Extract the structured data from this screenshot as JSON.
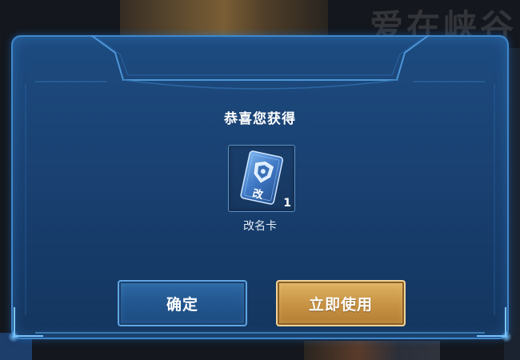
{
  "background": {
    "watermark_text": "爱在峡谷"
  },
  "dialog": {
    "title": "恭喜您获得",
    "item": {
      "icon": "rename-card-icon",
      "icon_text": "改",
      "count": "1",
      "name": "改名卡"
    },
    "buttons": {
      "confirm_label": "确定",
      "use_now_label": "立即使用"
    }
  },
  "colors": {
    "dialog_bg": "#1a4273",
    "frame_edge": "#3f87c9",
    "confirm_button": "#22568f",
    "use_button": "#c99445"
  }
}
